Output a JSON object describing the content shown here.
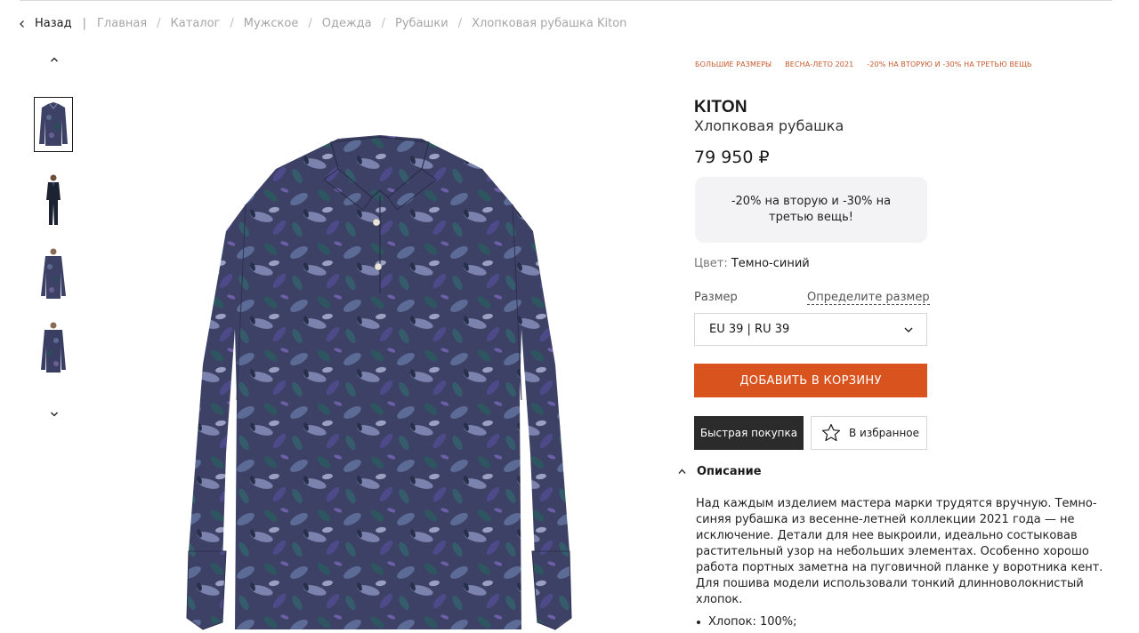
{
  "breadcrumb": {
    "back_label": "Назад",
    "separator": "|",
    "items": [
      "Главная",
      "Каталог",
      "Мужское",
      "Одежда",
      "Рубашки",
      "Хлопковая рубашка Kiton"
    ],
    "item_separator": "/"
  },
  "gallery": {
    "thumbnails": [
      "shirt-front",
      "model-full-look",
      "model-shirt-front",
      "model-shirt-side"
    ],
    "active_index": 0
  },
  "product": {
    "tags": [
      "БОЛЬШИЕ РАЗМЕРЫ",
      "ВЕСНА-ЛЕТО 2021",
      "-20% НА ВТОРУЮ И -30% НА ТРЕТЬЮ ВЕЩЬ"
    ],
    "brand": "KITON",
    "name": "Хлопковая рубашка",
    "price": "79 950 ₽",
    "promo_text": "-20% на вторую и -30% на третью вещь!",
    "color_label": "Цвет:",
    "color_value": "Темно-синий",
    "size_label": "Размер",
    "size_guide_label": "Определите размер",
    "size_selected": "EU 39 | RU 39"
  },
  "actions": {
    "add_to_cart": "ДОБАВИТЬ В КОРЗИНУ",
    "quick_buy": "Быстрая покупка",
    "favorite": "В избранное"
  },
  "description": {
    "header": "Описание",
    "text": "Над каждым изделием мастера марки трудятся вручную. Темно-синяя рубашка из весенне-летней коллекции 2021 года — не исключение. Детали для нее выкроили, идеально состыковав растительный узор на небольших элементах. Особенно хорошо работа портных заметна на пуговичной планке у воротника кент. Для пошива модели использовали тонкий длинноволокнистый хлопок.",
    "composition": "Хлопок: 100%;"
  },
  "colors": {
    "accent": "#d9531e",
    "tag": "#c65a2e",
    "dark_button": "#2b2b2b",
    "promo_bg": "#f3f3f6",
    "shirt_base": "#3d4166"
  },
  "icons": {
    "back": "chevron-left-icon",
    "gallery_up": "chevron-up-icon",
    "gallery_down": "chevron-down-icon",
    "select": "chevron-down-icon",
    "favorite": "star-outline-icon",
    "description_toggle": "chevron-up-icon"
  }
}
